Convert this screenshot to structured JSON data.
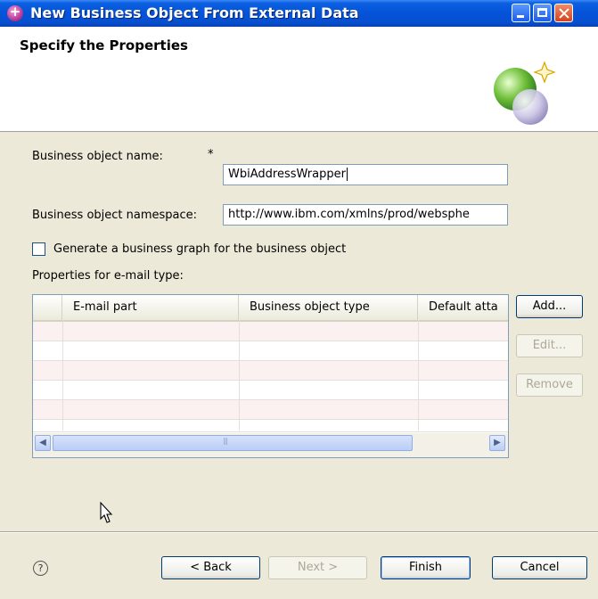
{
  "window": {
    "title": "New Business Object From External Data"
  },
  "header": {
    "title": "Specify the Properties"
  },
  "form": {
    "bo_name_label": "Business object name:",
    "bo_name_required": "*",
    "bo_name_value": "WbiAddressWrapper",
    "bo_namespace_label": "Business object namespace:",
    "bo_namespace_value": "http://www.ibm.com/xmlns/prod/websphe",
    "generate_graph_label": "Generate a business graph for the business object",
    "generate_graph_checked": false,
    "properties_label": "Properties for e-mail type:"
  },
  "table": {
    "columns": [
      "",
      "E-mail part",
      "Business object type",
      "Default atta"
    ],
    "rows": [
      [],
      [],
      [],
      [],
      [],
      []
    ]
  },
  "side_buttons": {
    "add": "Add...",
    "edit": "Edit...",
    "remove": "Remove"
  },
  "footer": {
    "help_icon": "?",
    "back": "< Back",
    "next": "Next >",
    "finish": "Finish",
    "cancel": "Cancel"
  },
  "icons": {
    "app": "wizard-app-icon",
    "banner": "wizard-spheres-graphic",
    "scroll_left": "◀",
    "scroll_right": "▶"
  },
  "colors": {
    "titlebar": "#0553d8",
    "dialog_bg": "#ece9d8",
    "field_border": "#7f9db9",
    "row_tint": "#fbf1f1"
  }
}
